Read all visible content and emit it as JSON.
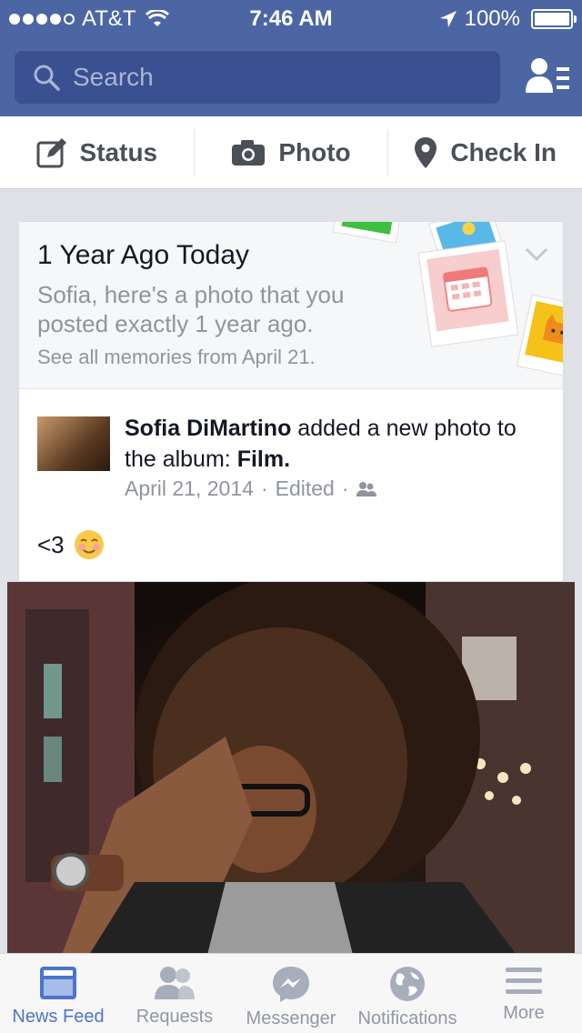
{
  "status_bar": {
    "carrier": "AT&T",
    "time": "7:46 AM",
    "battery": "100%"
  },
  "search": {
    "placeholder": "Search"
  },
  "composer": {
    "status": "Status",
    "photo": "Photo",
    "check_in": "Check In"
  },
  "memory": {
    "title": "1 Year Ago Today",
    "subtitle": "Sofia, here's a photo that you posted exactly 1 year ago.",
    "link": "See all memories from April 21."
  },
  "post": {
    "author": "Sofia DiMartino",
    "action": "added a new photo to the album:",
    "album": "Film.",
    "date": "April 21, 2014",
    "edited": "Edited",
    "body": "<3"
  },
  "tabs": [
    {
      "label": "News Feed",
      "icon": "news-feed-icon",
      "active": true
    },
    {
      "label": "Requests",
      "icon": "requests-icon",
      "active": false
    },
    {
      "label": "Messenger",
      "icon": "messenger-icon",
      "active": false
    },
    {
      "label": "Notifications",
      "icon": "globe-icon",
      "active": false
    },
    {
      "label": "More",
      "icon": "menu-icon",
      "active": false
    }
  ],
  "colors": {
    "brand": "#4c66a4",
    "tab_active": "#4e74c9"
  }
}
